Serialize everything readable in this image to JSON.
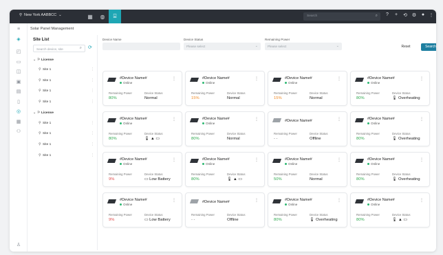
{
  "topbar": {
    "location": "New York AABBCC",
    "location_icon": "pin-icon",
    "search_placeholder": "Search",
    "tabs": [
      {
        "icon": "grid-icon",
        "glyph": "▦"
      },
      {
        "icon": "globe-icon",
        "glyph": "◍"
      },
      {
        "icon": "solar-panel-icon",
        "glyph": "⌸"
      }
    ],
    "icons": [
      {
        "name": "help-icon",
        "glyph": "?"
      },
      {
        "name": "plus-icon",
        "glyph": "+"
      },
      {
        "name": "sync-icon",
        "glyph": "⟲"
      },
      {
        "name": "settings-icon",
        "glyph": "⚙"
      },
      {
        "name": "user-icon",
        "glyph": "●"
      },
      {
        "name": "more-icon",
        "glyph": "⋮"
      }
    ]
  },
  "breadcrumb": "Solar Panel Management",
  "site_list": {
    "title": "Site List",
    "search_placeholder": "Search device, site",
    "groups": [
      {
        "label": "License",
        "sites": [
          "Site 1",
          "Site 1",
          "Site 1",
          "Site 1"
        ]
      },
      {
        "label": "License",
        "sites": [
          "Site 1",
          "Site 1",
          "Site 1",
          "Site 1"
        ]
      }
    ]
  },
  "filters": {
    "device_name_label": "Device Name",
    "device_status_label": "Device Status",
    "device_status_placeholder": "Please select",
    "remaining_power_label": "Remaining Power",
    "remaining_power_placeholder": "Please select",
    "reset_label": "Reset",
    "search_label": "Search"
  },
  "labels": {
    "remaining_power": "Remaining Power",
    "device_status": "Device Status"
  },
  "cards": [
    {
      "name": "#Device Name#",
      "online": "Online",
      "power": "80%",
      "power_color": "green",
      "status": "Normal",
      "status_color": "normal"
    },
    {
      "name": "#Device Name#",
      "online": "Online",
      "power": "15%",
      "power_color": "orange",
      "status": "Normal",
      "status_color": "normal"
    },
    {
      "name": "#Device Name#",
      "online": "Online",
      "power": "15%",
      "power_color": "orange",
      "status": "Normal",
      "status_color": "normal"
    },
    {
      "name": "#Device Name#",
      "online": "Online",
      "power": "80%",
      "power_color": "green",
      "status": "Overheating",
      "status_color": "red"
    },
    {
      "name": "#Device Name#",
      "online": "Online",
      "power": "80%",
      "power_color": "green",
      "status": "🌡 ▲ ▭",
      "status_color": "red"
    },
    {
      "name": "#Device Name#",
      "online": "Online",
      "power": "80%",
      "power_color": "green",
      "status": "Normal",
      "status_color": "normal"
    },
    {
      "name": "#Device Name#",
      "online": "",
      "power": "- -",
      "power_color": "gray",
      "status": "Offline",
      "status_color": "normal"
    },
    {
      "name": "#Device Name#",
      "online": "Online",
      "power": "80%",
      "power_color": "green",
      "status": "Overheating",
      "status_color": "red"
    },
    {
      "name": "#Device Name#",
      "online": "Online",
      "power": "9%",
      "power_color": "red",
      "status": "Low Battery",
      "status_color": "red"
    },
    {
      "name": "#Device Name#",
      "online": "Online",
      "power": "80%",
      "power_color": "green",
      "status": "🌡 ▲ ▭",
      "status_color": "red"
    },
    {
      "name": "#Device Name#",
      "online": "Online",
      "power": "50%",
      "power_color": "green",
      "status": "Normal",
      "status_color": "normal"
    },
    {
      "name": "#Device Name#",
      "online": "Online",
      "power": "80%",
      "power_color": "green",
      "status": "Overheating",
      "status_color": "red"
    },
    {
      "name": "#Device Name#",
      "online": "Online",
      "power": "9%",
      "power_color": "red",
      "status": "Low Battery",
      "status_color": "red"
    },
    {
      "name": "#Device Name#",
      "online": "",
      "power": "- -",
      "power_color": "gray",
      "status": "Offline",
      "status_color": "normal"
    },
    {
      "name": "#Device Name#",
      "online": "Online",
      "power": "80%",
      "power_color": "green",
      "status": "Overheating",
      "status_color": "red"
    },
    {
      "name": "#Device Name#",
      "online": "Online",
      "power": "80%",
      "power_color": "green",
      "status": "🌡 ▲ ▭",
      "status_color": "red"
    }
  ]
}
